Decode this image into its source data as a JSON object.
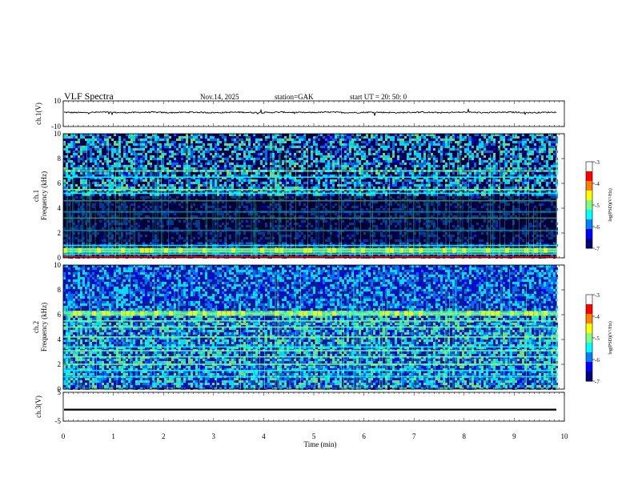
{
  "header": {
    "title": "VLF  Spectra",
    "date": "Nov.14, 2025",
    "station": "station=GAK",
    "start": "start  UT  =    20: 50: 0"
  },
  "chart_data": [
    {
      "type": "line",
      "ylabel": "ch.1(V)",
      "ylim": [
        -10,
        10
      ],
      "yticks": [
        "10",
        "-10"
      ],
      "xlim": [
        0,
        10
      ],
      "series": [
        {
          "baseline": 1.0,
          "noise": 0.5
        }
      ]
    },
    {
      "type": "heatmap",
      "ylabel_top": "ch.1",
      "ylabel": "Frequency (kHz)",
      "ylim": [
        0,
        10
      ],
      "yticks": [
        "0",
        "2",
        "4",
        "6",
        "8",
        "10"
      ],
      "xlim": [
        0,
        9.85
      ],
      "colorbar": {
        "label": "log(PSD)(V²/Hz)",
        "range": [
          -7,
          -3
        ],
        "ticks": [
          "-3",
          "-4",
          "-5",
          "-6",
          "-7"
        ]
      },
      "bands_khz": [
        0.3,
        0.5,
        0.7,
        1.0,
        2.2,
        3.2,
        3.7,
        4.6,
        5.2,
        5.5,
        6.5,
        7.0
      ],
      "bright_band_khz": [
        0.4,
        0.8
      ]
    },
    {
      "type": "heatmap",
      "ylabel_top": "ch.2",
      "ylabel": "Frequency (kHz)",
      "ylim": [
        0,
        10
      ],
      "yticks": [
        "0",
        "2",
        "4",
        "6",
        "8",
        "10"
      ],
      "xlim": [
        0,
        9.85
      ],
      "colorbar": {
        "label": "log(PSD)(V²/Hz)",
        "range": [
          -7,
          -3
        ],
        "ticks": [
          "-3",
          "-4",
          "-5",
          "-6",
          "-7"
        ]
      },
      "bands_khz": [
        1.0,
        1.5,
        2.0,
        2.6,
        3.1,
        3.4,
        4.2,
        5.0,
        5.5,
        6.1
      ],
      "bright_band_khz": [
        5.9,
        6.3
      ]
    },
    {
      "type": "line",
      "ylabel": "ch.3(V)",
      "ylim": [
        -5,
        5
      ],
      "yticks": [
        "5",
        "-5"
      ],
      "xlim": [
        0,
        10
      ],
      "series": [
        {
          "baseline": -1.0
        }
      ]
    }
  ],
  "xaxis": {
    "label": "Time  (min)",
    "ticks": [
      "0",
      "1",
      "2",
      "3",
      "4",
      "5",
      "6",
      "7",
      "8",
      "9",
      "10"
    ],
    "range": [
      0,
      10
    ]
  },
  "colors": {
    "jet": [
      "#00007f",
      "#0000ff",
      "#007fff",
      "#00ffff",
      "#7fff7f",
      "#ffff00",
      "#ff7f00",
      "#ff0000",
      "#7f0000"
    ]
  }
}
